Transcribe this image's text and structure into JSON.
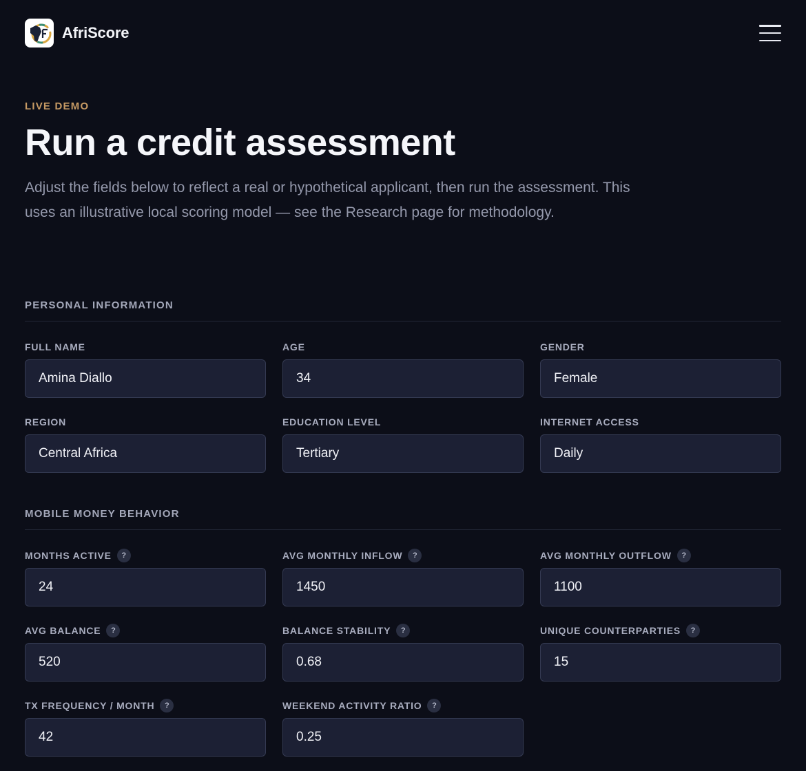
{
  "header": {
    "brand_name": "AfriScore",
    "menu_icon": "hamburger-menu-icon"
  },
  "hero": {
    "eyebrow": "LIVE DEMO",
    "title": "Run a credit assessment",
    "description": "Adjust the fields below to reflect a real or hypothetical applicant, then run the assessment. This uses an illustrative local scoring model — see the Research page for methodology."
  },
  "personal": {
    "title": "PERSONAL INFORMATION",
    "fields": [
      {
        "label": "FULL NAME",
        "value": "Amina Diallo"
      },
      {
        "label": "AGE",
        "value": "34"
      },
      {
        "label": "GENDER",
        "value": "Female"
      },
      {
        "label": "REGION",
        "value": "Central Africa"
      },
      {
        "label": "EDUCATION LEVEL",
        "value": "Tertiary"
      },
      {
        "label": "INTERNET ACCESS",
        "value": "Daily"
      }
    ]
  },
  "mobile_money": {
    "title": "MOBILE MONEY BEHAVIOR",
    "help_glyph": "?",
    "fields": [
      {
        "label": "MONTHS ACTIVE",
        "value": "24"
      },
      {
        "label": "AVG MONTHLY INFLOW",
        "value": "1450"
      },
      {
        "label": "AVG MONTHLY OUTFLOW",
        "value": "1100"
      },
      {
        "label": "AVG BALANCE",
        "value": "520"
      },
      {
        "label": "BALANCE STABILITY",
        "value": "0.68"
      },
      {
        "label": "UNIQUE COUNTERPARTIES",
        "value": "15"
      },
      {
        "label": "TX FREQUENCY / MONTH",
        "value": "42"
      },
      {
        "label": "WEEKEND ACTIVITY RATIO",
        "value": "0.25"
      }
    ]
  },
  "colors": {
    "background": "#0c0e18",
    "accent": "#c79a64",
    "input_bg": "#1c2034",
    "input_border": "#343a52"
  }
}
